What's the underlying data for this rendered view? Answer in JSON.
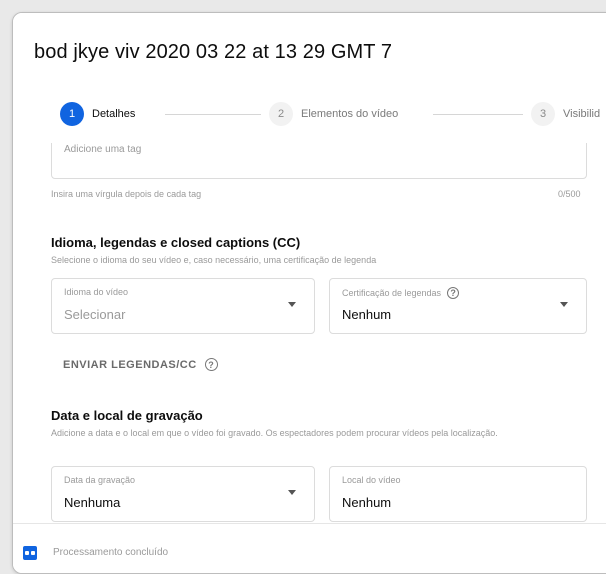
{
  "dialog": {
    "title": "bod jkye viv 2020 03 22 at 13 29 GMT 7"
  },
  "stepper": {
    "steps": [
      {
        "number": "1",
        "label": "Detalhes"
      },
      {
        "number": "2",
        "label": "Elementos do vídeo"
      },
      {
        "number": "3",
        "label": "Visibilid"
      }
    ]
  },
  "tags": {
    "placeholder": "Adicione uma tag",
    "hint": "Insira uma vírgula depois de cada tag",
    "counter": "0/500"
  },
  "language_section": {
    "title": "Idioma, legendas e closed captions (CC)",
    "description": "Selecione o idioma do seu vídeo e, caso necessário, uma certificação de legenda",
    "video_language": {
      "label": "Idioma do vídeo",
      "value": "Selecionar"
    },
    "caption_cert": {
      "label": "Certificação de legendas",
      "value": "Nenhum",
      "help_icon": "help-icon"
    },
    "upload_button": {
      "label": "ENVIAR LEGENDAS/CC",
      "help_icon": "help-icon"
    }
  },
  "recording_section": {
    "title": "Data e local de gravação",
    "description": "Adicione a data e o local em que o vídeo foi gravado. Os espectadores podem procurar vídeos pela localização.",
    "date": {
      "label": "Data da gravação",
      "value": "Nenhuma"
    },
    "location": {
      "label": "Local do vídeo",
      "value": "Nenhum"
    }
  },
  "footer": {
    "status_text": "Processamento concluído",
    "icon": "processing-icon"
  },
  "colors": {
    "accent": "#1064e0"
  }
}
